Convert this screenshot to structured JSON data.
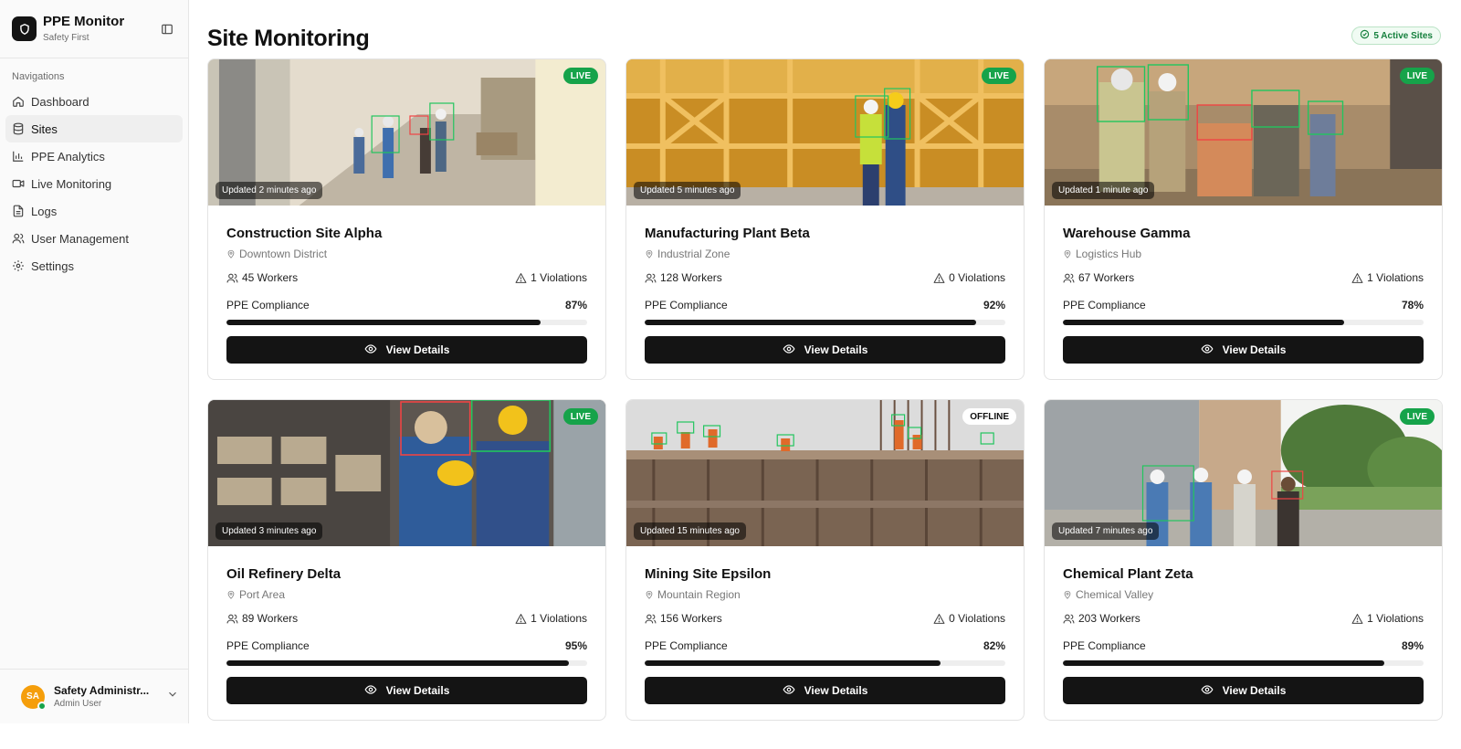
{
  "sidebar": {
    "brand_name": "PPE Monitor",
    "brand_sub": "Safety First",
    "nav_heading": "Navigations",
    "items": [
      {
        "label": "Dashboard",
        "icon": "home-icon"
      },
      {
        "label": "Sites",
        "icon": "database-icon",
        "active": true
      },
      {
        "label": "PPE Analytics",
        "icon": "bar-chart-icon"
      },
      {
        "label": "Live Monitoring",
        "icon": "video-icon"
      },
      {
        "label": "Logs",
        "icon": "file-text-icon"
      },
      {
        "label": "User Management",
        "icon": "users-icon"
      },
      {
        "label": "Settings",
        "icon": "gear-icon"
      }
    ],
    "user": {
      "initials": "SA",
      "name": "Safety Administr...",
      "role": "Admin User"
    }
  },
  "header": {
    "title": "Site Monitoring",
    "active_badge": "5 Active Sites"
  },
  "button_label": "View Details",
  "compliance_label": "PPE Compliance",
  "sites": [
    {
      "name": "Construction Site Alpha",
      "location": "Downtown District",
      "workers": "45 Workers",
      "violations": "1 Violations",
      "compliance": "87%",
      "compliance_value": 87,
      "status": "LIVE",
      "updated": "Updated 2 minutes ago"
    },
    {
      "name": "Manufacturing Plant Beta",
      "location": "Industrial Zone",
      "workers": "128 Workers",
      "violations": "0 Violations",
      "compliance": "92%",
      "compliance_value": 92,
      "status": "LIVE",
      "updated": "Updated 5 minutes ago"
    },
    {
      "name": "Warehouse Gamma",
      "location": "Logistics Hub",
      "workers": "67 Workers",
      "violations": "1 Violations",
      "compliance": "78%",
      "compliance_value": 78,
      "status": "LIVE",
      "updated": "Updated 1 minute ago"
    },
    {
      "name": "Oil Refinery Delta",
      "location": "Port Area",
      "workers": "89 Workers",
      "violations": "1 Violations",
      "compliance": "95%",
      "compliance_value": 95,
      "status": "LIVE",
      "updated": "Updated 3 minutes ago"
    },
    {
      "name": "Mining Site Epsilon",
      "location": "Mountain Region",
      "workers": "156 Workers",
      "violations": "0 Violations",
      "compliance": "82%",
      "compliance_value": 82,
      "status": "OFFLINE",
      "updated": "Updated 15 minutes ago"
    },
    {
      "name": "Chemical Plant Zeta",
      "location": "Chemical Valley",
      "workers": "203 Workers",
      "violations": "1 Violations",
      "compliance": "89%",
      "compliance_value": 89,
      "status": "LIVE",
      "updated": "Updated 7 minutes ago"
    }
  ],
  "colors": {
    "live": "#16a34a",
    "primary": "#141414",
    "avatar": "#f59e0b"
  }
}
